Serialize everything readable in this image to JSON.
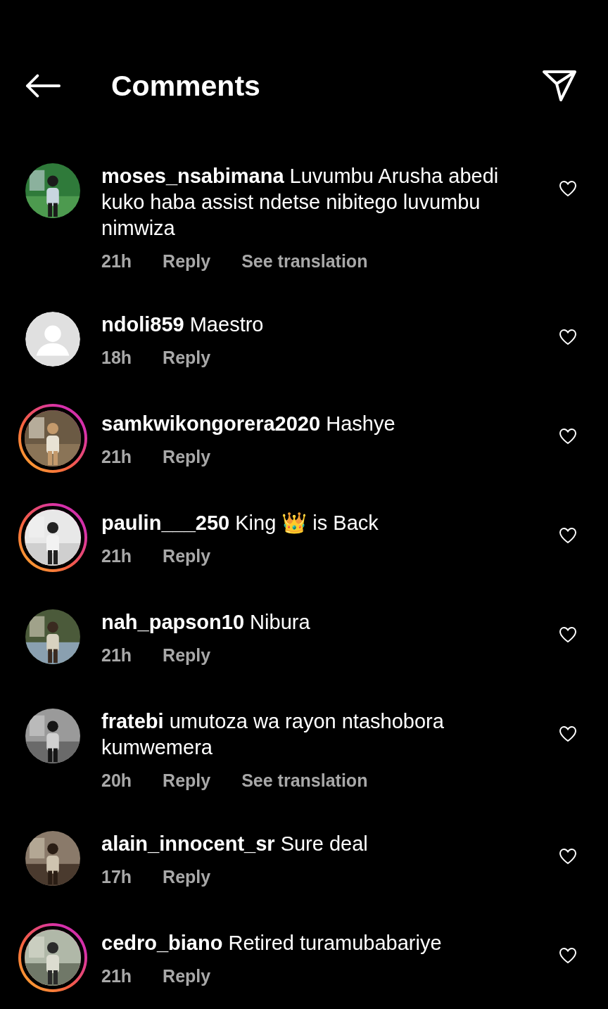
{
  "header": {
    "title": "Comments"
  },
  "comments": [
    {
      "username": "moses_nsabimana",
      "text": "Luvumbu Arusha abedi kuko haba assist ndetse nibitego luvumbu nimwiza",
      "time": "21h",
      "reply": "Reply",
      "translate": "See translation",
      "avatar": {
        "kind": "picture",
        "story_ring": false
      },
      "liked": false
    },
    {
      "username": "ndoli859",
      "text": "Maestro",
      "time": "18h",
      "reply": "Reply",
      "avatar": {
        "kind": "default",
        "story_ring": false
      },
      "liked": false
    },
    {
      "username": "samkwikongorera2020",
      "text": "Hashye",
      "time": "21h",
      "reply": "Reply",
      "avatar": {
        "kind": "picture",
        "story_ring": true
      },
      "liked": false
    },
    {
      "username": "paulin___250",
      "text": "King 👑 is Back",
      "time": "21h",
      "reply": "Reply",
      "avatar": {
        "kind": "picture",
        "story_ring": true
      },
      "liked": false
    },
    {
      "username": "nah_papson10",
      "text": "Nibura",
      "time": "21h",
      "reply": "Reply",
      "avatar": {
        "kind": "picture",
        "story_ring": false
      },
      "liked": false
    },
    {
      "username": "fratebi",
      "text": "umutoza wa rayon ntashobora kumwemera",
      "time": "20h",
      "reply": "Reply",
      "translate": "See translation",
      "avatar": {
        "kind": "picture",
        "story_ring": false
      },
      "liked": false
    },
    {
      "username": "alain_innocent_sr",
      "text": "Sure deal",
      "time": "17h",
      "reply": "Reply",
      "avatar": {
        "kind": "picture",
        "story_ring": false
      },
      "liked": false
    },
    {
      "username": "cedro_biano",
      "text": "Retired turamubabariye",
      "time": "21h",
      "reply": "Reply",
      "avatar": {
        "kind": "picture",
        "story_ring": true
      },
      "liked": false
    }
  ]
}
